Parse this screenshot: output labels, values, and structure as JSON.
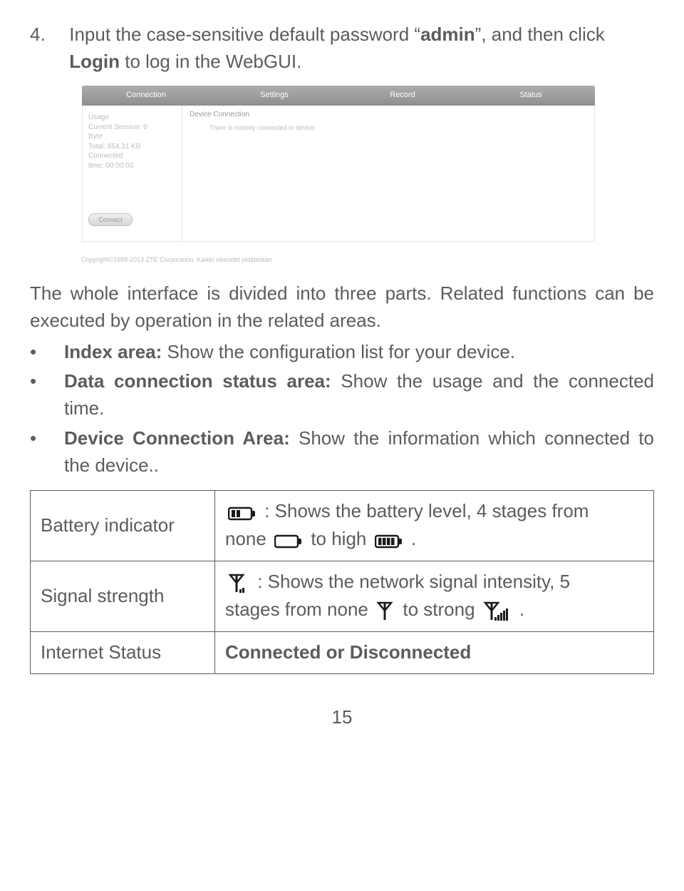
{
  "step": {
    "num": "4.",
    "text_a": "Input the case-sensitive default password “",
    "pwd": "admin",
    "text_b": "”, and then click ",
    "login": "Login",
    "text_c": " to log in the WebGUI."
  },
  "webgui": {
    "tabs": [
      "Connection",
      "Settings",
      "Record",
      "Status"
    ],
    "side_lines": [
      "Usage",
      "Current Session: 0",
      "Byte",
      "Total: 854.31 KB",
      "",
      "Connected",
      "time: 00:00:00"
    ],
    "connect_btn": "Connect",
    "content_header": "Device Connection",
    "content_sub": "There is nobody connected to device.",
    "copyright": "Copyright©1998-2013 ZTE Corporation. Kaikki oikeudet pidätetään"
  },
  "para1": "The whole interface is divided into three parts. Related functions can be executed by operation in the related areas.",
  "bullets": [
    {
      "bold": "Index area:",
      "rest": " Show the configuration list for your device."
    },
    {
      "bold": "Data connection status area:",
      "rest": " Show the usage and the connected time."
    },
    {
      "bold": "Device Connection Area:",
      "rest": " Show the information which connected to the device.."
    }
  ],
  "table": {
    "r1_left": "Battery indicator",
    "r1_a": " : Shows the battery level, 4 stages from",
    "r1_b": "none ",
    "r1_c": " to high ",
    "r1_d": " .",
    "r2_left": "Signal strength",
    "r2_a": " : Shows the network signal intensity, 5",
    "r2_b": "stages from none ",
    "r2_c": " to strong ",
    "r2_d": " .",
    "r3_left": "Internet Status",
    "r3_right": "Connected or Disconnected"
  },
  "page_num": "15"
}
